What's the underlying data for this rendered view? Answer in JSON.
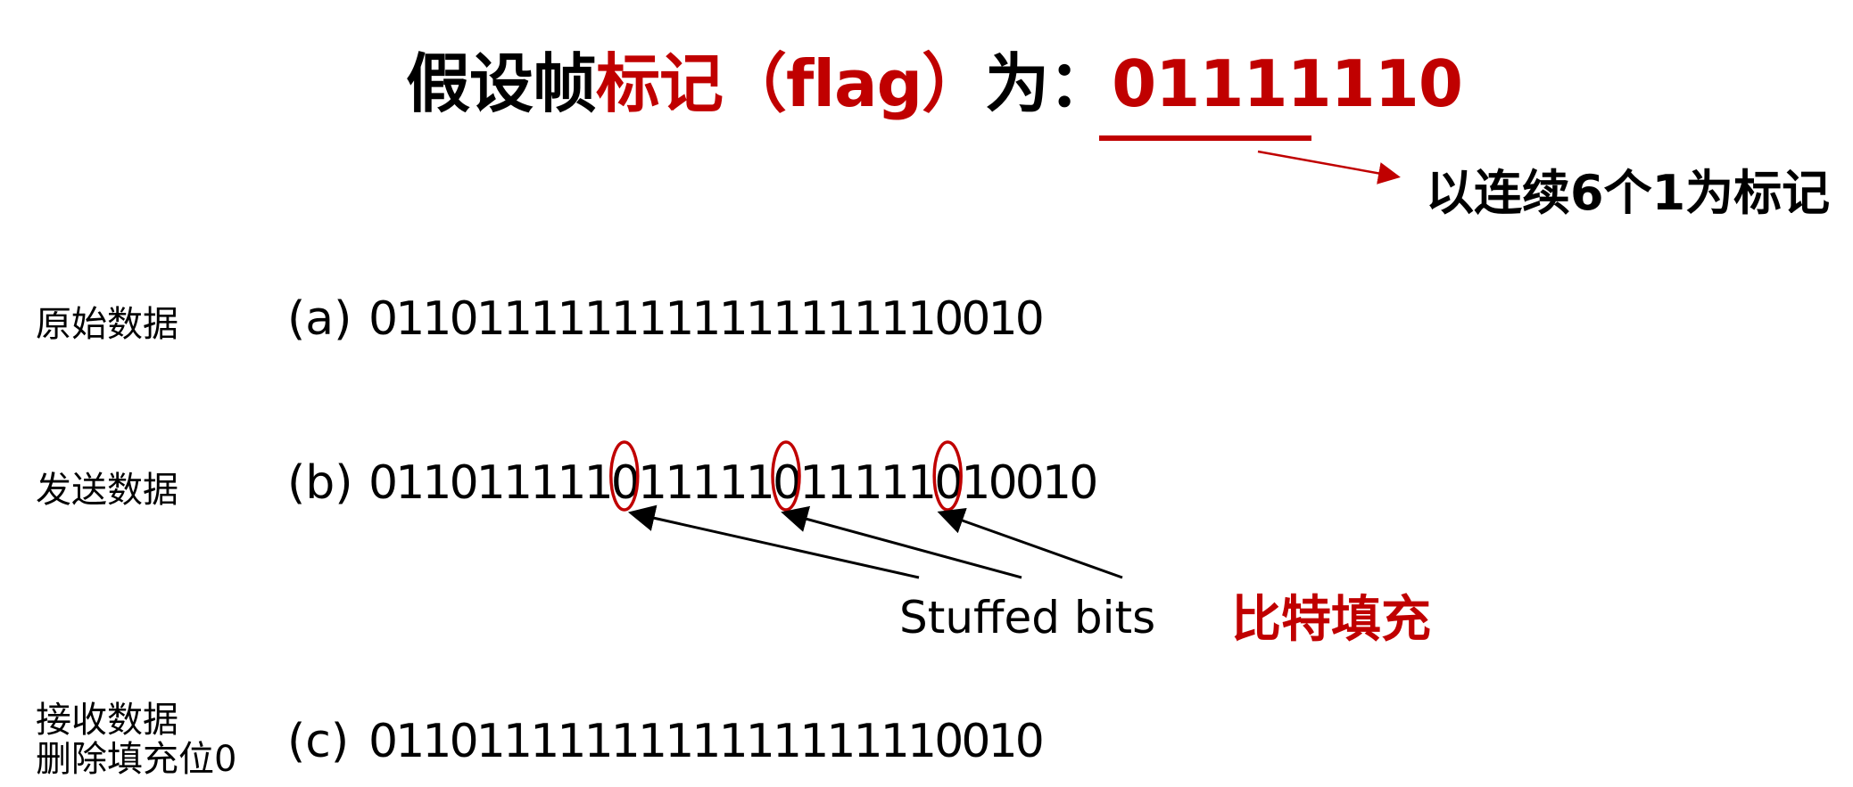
{
  "title": {
    "part1": "假设帧",
    "part2": "标记（flag）",
    "part3": "为：",
    "part4": "01111110"
  },
  "note": "以连续6个1为标记",
  "rows": [
    {
      "label_lines": [
        "原始数据"
      ],
      "tag": "(a)",
      "bits": "0110111111111111111110010"
    },
    {
      "label_lines": [
        "发送数据"
      ],
      "tag": "(b)",
      "bits": "011011111011111011111010010",
      "stuffed_indices": [
        9,
        15,
        21
      ]
    },
    {
      "label_lines": [
        "接收数据",
        "删除填充位0"
      ],
      "tag": "(c)",
      "bits": "0110111111111111111110010"
    }
  ],
  "annotation": {
    "stuffed_bits": "Stuffed bits",
    "stuffed_cn": "比特填充"
  },
  "colors": {
    "accent": "#c00000",
    "text": "#000000"
  }
}
